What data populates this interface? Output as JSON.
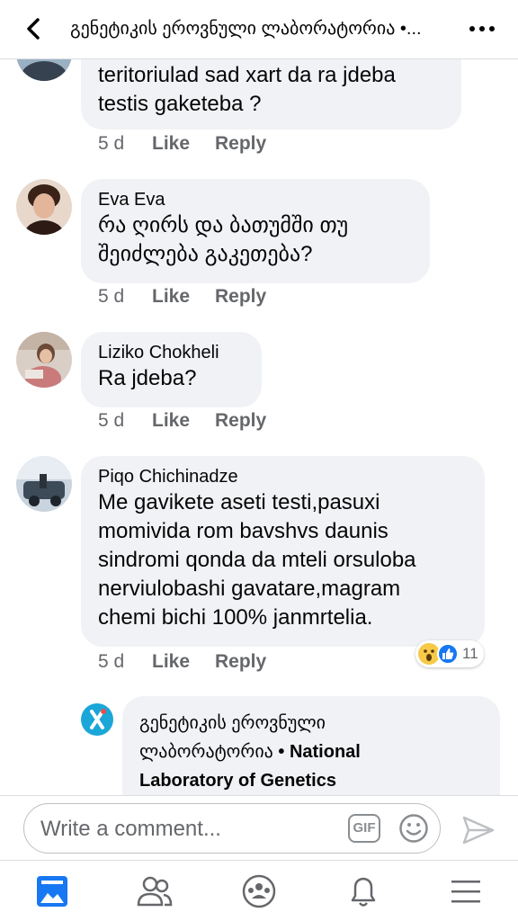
{
  "header": {
    "title": "გენეტიკის ეროვნული ლაბორატორია •...",
    "back_icon": "chevron-left-icon",
    "more_icon": "ellipsis-icon"
  },
  "comments": [
    {
      "author": "",
      "text": "teritoriulad sad xart da ra jdeba\ntestis gaketeba ?",
      "time": "5 d",
      "like_label": "Like",
      "reply_label": "Reply"
    },
    {
      "author": "Eva Eva",
      "text": "რა ღირს და ბათუმში თუ\nშეიძლება  გაკეთება?",
      "time": "5 d",
      "like_label": "Like",
      "reply_label": "Reply"
    },
    {
      "author": "Liziko Chokheli",
      "text": "Ra jdeba?",
      "time": "5 d",
      "like_label": "Like",
      "reply_label": "Reply"
    },
    {
      "author": "Piqo Chichinadze",
      "text": "Me gavikete aseti testi,pasuxi\nmomivida rom bavshvs daunis\nsindromi qonda da mteli orsuloba\nnerviulobashi gavatare,magram\nchemi bichi 100% janmrtelia.",
      "time": "5 d",
      "like_label": "Like",
      "reply_label": "Reply",
      "reaction_count": "11",
      "reactions": [
        "wow-icon",
        "like-icon"
      ]
    }
  ],
  "reply": {
    "author_line1": "გენეტიკის ეროვნული",
    "author_line2_georgian": "ლაბორატორია",
    "author_line2_english": " • National",
    "author_line3": "Laboratory of Genetics"
  },
  "composer": {
    "placeholder": "Write a comment...",
    "gif_label": "GIF",
    "emoji_icon": "smiley-icon",
    "send_icon": "send-icon"
  },
  "tabbar": {
    "items": [
      "news-feed-icon",
      "friends-icon",
      "groups-icon",
      "notifications-icon",
      "menu-icon"
    ],
    "active": "news-feed-icon"
  },
  "colors": {
    "accent": "#1877f2",
    "bubble": "#f0f2f5",
    "muted_text": "#65676b"
  }
}
